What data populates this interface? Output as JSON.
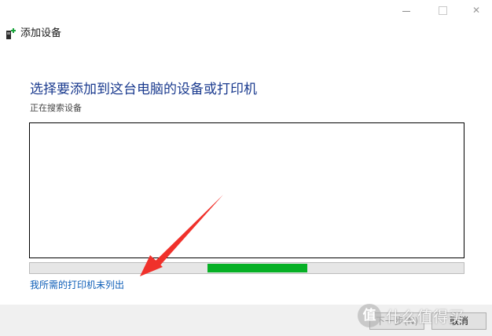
{
  "window": {
    "title": "添加设备",
    "minimize_icon": "minimize-icon",
    "maximize_icon": "maximize-icon",
    "close_glyph": "✕"
  },
  "main": {
    "heading": "选择要添加到这台电脑的设备或打印机",
    "status": "正在搜索设备",
    "progress": {
      "indeterminate": true,
      "segment_start": 0.41,
      "segment_end": 0.64,
      "color": "#06b025"
    },
    "printer_link": "我所需的打印机未列出"
  },
  "footer": {
    "next_label": "下一步(N)",
    "cancel_label": "取消"
  },
  "watermark": {
    "badge": "值",
    "text": "什么值得买"
  },
  "colors": {
    "heading": "#1b3b8f",
    "link": "#0f5fb8",
    "annotation_arrow": "#f0312b"
  }
}
